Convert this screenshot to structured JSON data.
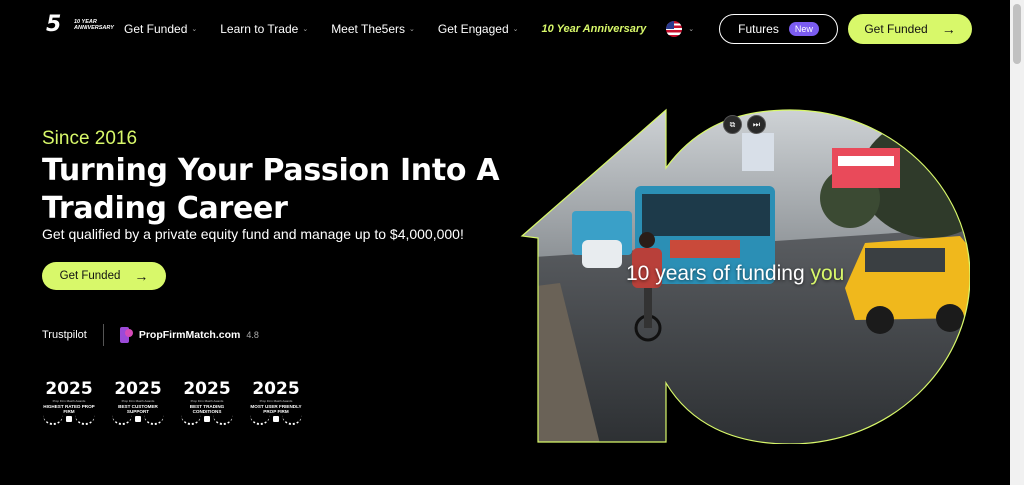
{
  "header": {
    "logo_number": "5",
    "logo_sub": "10 YEAR ANNIVERSARY",
    "nav": [
      {
        "label": "Get Funded"
      },
      {
        "label": "Learn to Trade"
      },
      {
        "label": "Meet The5ers"
      },
      {
        "label": "Get Engaged"
      }
    ],
    "anniversary": "10 Year Anniversary",
    "futures_label": "Futures",
    "new_badge": "New",
    "cta_label": "Get Funded"
  },
  "hero": {
    "since": "Since 2016",
    "headline": "Turning Your Passion Into A Trading Career",
    "subline": "Get qualified by a private equity fund and manage up to $4,000,000!",
    "cta_label": "Get Funded",
    "video_text_main": "10 years of funding ",
    "video_text_highlight": "you"
  },
  "ratings": {
    "trustpilot": "Trustpilot",
    "pfm_name": "PropFirmMatch.com",
    "pfm_score": "4.8"
  },
  "awards": [
    {
      "year": "2025",
      "small": "Prop Firm Match Awards",
      "title": "HIGHEST RATED PROP FIRM"
    },
    {
      "year": "2025",
      "small": "Prop Firm Match Awards",
      "title": "BEST CUSTOMER SUPPORT"
    },
    {
      "year": "2025",
      "small": "Prop Firm Match Awards",
      "title": "BEST TRADING CONDITIONS"
    },
    {
      "year": "2025",
      "small": "Prop Firm Match Awards",
      "title": "MOST USER FRIENDLY PROP FIRM"
    }
  ],
  "colors": {
    "accent": "#d8f86a",
    "badge": "#7b5cf0",
    "background": "#000000"
  }
}
